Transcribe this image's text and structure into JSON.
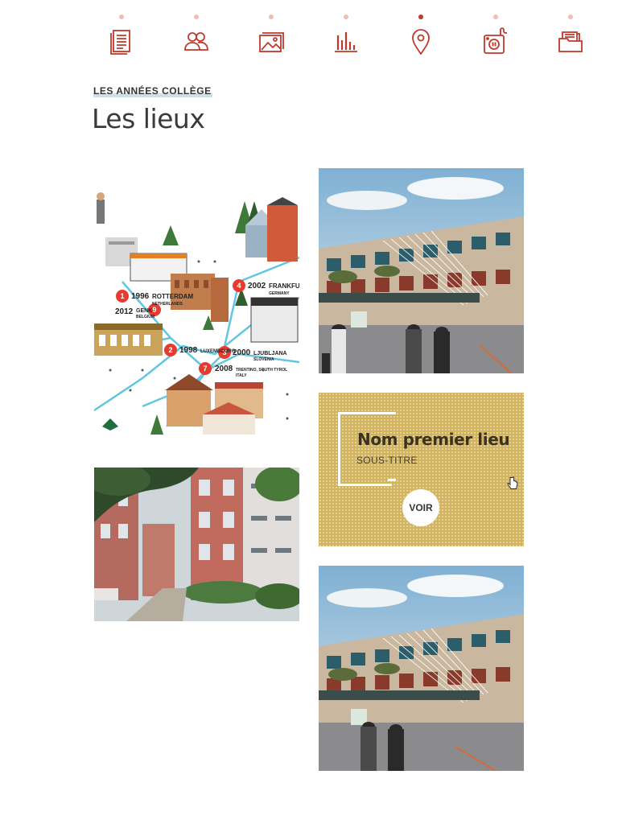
{
  "nav": {
    "items": [
      {
        "name": "document-icon",
        "active": false
      },
      {
        "name": "people-icon",
        "active": false
      },
      {
        "name": "images-icon",
        "active": false
      },
      {
        "name": "bar-chart-icon",
        "active": false
      },
      {
        "name": "location-pin-icon",
        "active": true
      },
      {
        "name": "audio-player-icon",
        "active": false
      },
      {
        "name": "folder-icon",
        "active": false
      }
    ]
  },
  "section": {
    "label": "LES ANNÉES COLLÈGE",
    "title": "Les lieux"
  },
  "map_labels": [
    {
      "num": "1",
      "year": "1996",
      "city": "ROTTERDAM",
      "country": "NETHERLANDS"
    },
    {
      "num": "9",
      "year": "2012",
      "city": "GENK",
      "country": "BELGIUM"
    },
    {
      "num": "4",
      "year": "2002",
      "city": "FRANKFURT",
      "country": "GERMANY"
    },
    {
      "num": "2",
      "year": "1998",
      "city": "LUXEMBOURG",
      "country": ""
    },
    {
      "num": "3",
      "year": "2000",
      "city": "LJUBLJANA",
      "country": "SLOVENIA"
    },
    {
      "num": "7",
      "year": "2008",
      "city": "TRENTINO, SOUTH TYROL",
      "country": "ITALY"
    }
  ],
  "featured": {
    "title": "Nom premier lieu",
    "subtitle": "SOUS-TITRE",
    "button": "VOIR"
  },
  "colors": {
    "accent": "#c0392b",
    "accent_light": "#f1bdb2",
    "featured_bg": "#d2b45f",
    "label_underline": "#cfe1e6"
  }
}
